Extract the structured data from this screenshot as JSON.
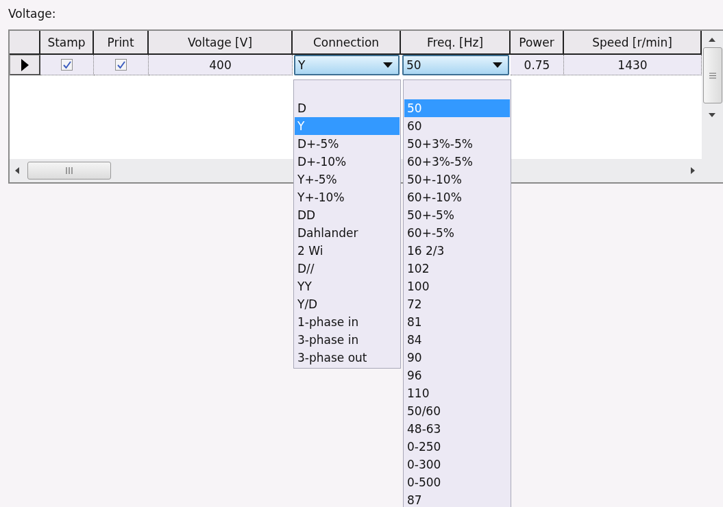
{
  "label": "Voltage:",
  "table": {
    "columns": [
      "Stamp",
      "Print",
      "Voltage [V]",
      "Connection",
      "Freq. [Hz]",
      "Power",
      "Speed [r/min]"
    ],
    "rows": [
      {
        "current": true,
        "stamp": true,
        "print": true,
        "voltage": "400",
        "connection": "Y",
        "frequency": "50",
        "power": "0.75",
        "speed": "1430"
      }
    ]
  },
  "connection_dropdown": {
    "options": [
      {
        "label": "D",
        "selected": false
      },
      {
        "label": "Y",
        "selected": true
      },
      {
        "label": "D+-5%",
        "selected": false
      },
      {
        "label": "D+-10%",
        "selected": false
      },
      {
        "label": "Y+-5%",
        "selected": false
      },
      {
        "label": "Y+-10%",
        "selected": false
      },
      {
        "label": "DD",
        "selected": false
      },
      {
        "label": "Dahlander",
        "selected": false
      },
      {
        "label": "2 Wi",
        "selected": false
      },
      {
        "label": "D//",
        "selected": false
      },
      {
        "label": "YY",
        "selected": false
      },
      {
        "label": "Y/D",
        "selected": false
      },
      {
        "label": "1-phase in",
        "selected": false
      },
      {
        "label": "3-phase in",
        "selected": false
      },
      {
        "label": "3-phase out",
        "selected": false
      }
    ]
  },
  "frequency_dropdown": {
    "options": [
      {
        "label": "50",
        "selected": true
      },
      {
        "label": "60",
        "selected": false
      },
      {
        "label": "50+3%-5%",
        "selected": false
      },
      {
        "label": "60+3%-5%",
        "selected": false
      },
      {
        "label": "50+-10%",
        "selected": false
      },
      {
        "label": "60+-10%",
        "selected": false
      },
      {
        "label": "50+-5%",
        "selected": false
      },
      {
        "label": "60+-5%",
        "selected": false
      },
      {
        "label": "16 2/3",
        "selected": false
      },
      {
        "label": "102",
        "selected": false
      },
      {
        "label": "100",
        "selected": false
      },
      {
        "label": "72",
        "selected": false
      },
      {
        "label": "81",
        "selected": false
      },
      {
        "label": "84",
        "selected": false
      },
      {
        "label": "90",
        "selected": false
      },
      {
        "label": "96",
        "selected": false
      },
      {
        "label": "110",
        "selected": false
      },
      {
        "label": "50/60",
        "selected": false
      },
      {
        "label": "48-63",
        "selected": false
      },
      {
        "label": "0-250",
        "selected": false
      },
      {
        "label": "0-300",
        "selected": false
      },
      {
        "label": "0-500",
        "selected": false
      },
      {
        "label": "87",
        "selected": false
      }
    ]
  }
}
